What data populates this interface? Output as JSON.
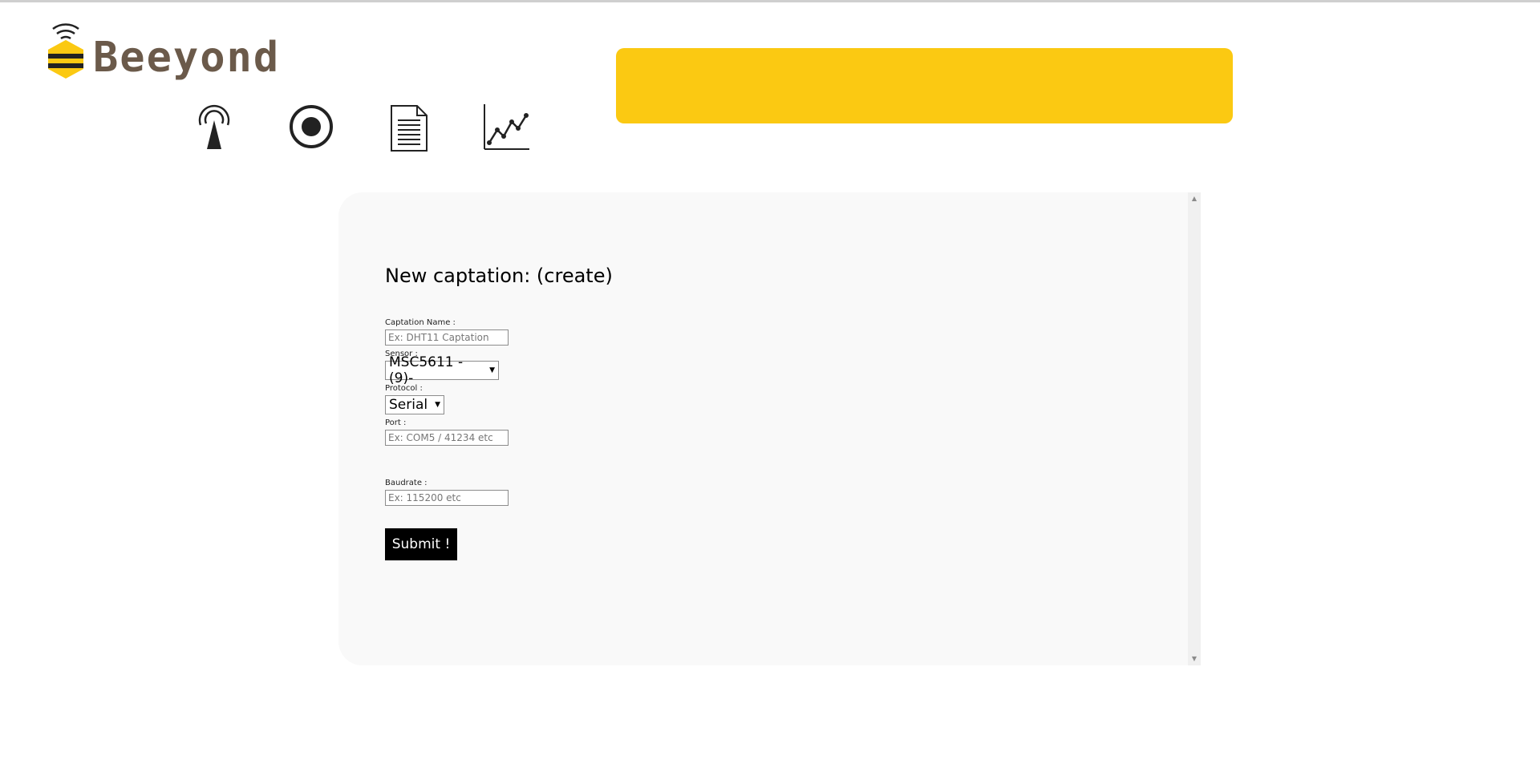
{
  "app": {
    "logo_text": "Beeyond"
  },
  "nav": {
    "items": [
      {
        "icon": "antenna-icon"
      },
      {
        "icon": "target-icon"
      },
      {
        "icon": "document-icon"
      },
      {
        "icon": "line-chart-icon"
      }
    ]
  },
  "colors": {
    "accent": "#fbc912",
    "brand_text": "#6b5a4a",
    "panel_bg": "#f9f9f9",
    "submit_bg": "#000000"
  },
  "form": {
    "title": "New captation: (create)",
    "captation_name": {
      "label": "Captation Name :",
      "placeholder": "Ex: DHT11 Captation",
      "value": ""
    },
    "sensor": {
      "label": "Sensor :",
      "selected": "MSC5611 -(9)-"
    },
    "protocol": {
      "label": "Protocol :",
      "selected": "Serial"
    },
    "port": {
      "label": "Port :",
      "placeholder": "Ex: COM5 / 41234 etc",
      "value": ""
    },
    "baudrate": {
      "label": "Baudrate :",
      "placeholder": "Ex: 115200 etc",
      "value": ""
    },
    "submit_label": "Submit !"
  }
}
